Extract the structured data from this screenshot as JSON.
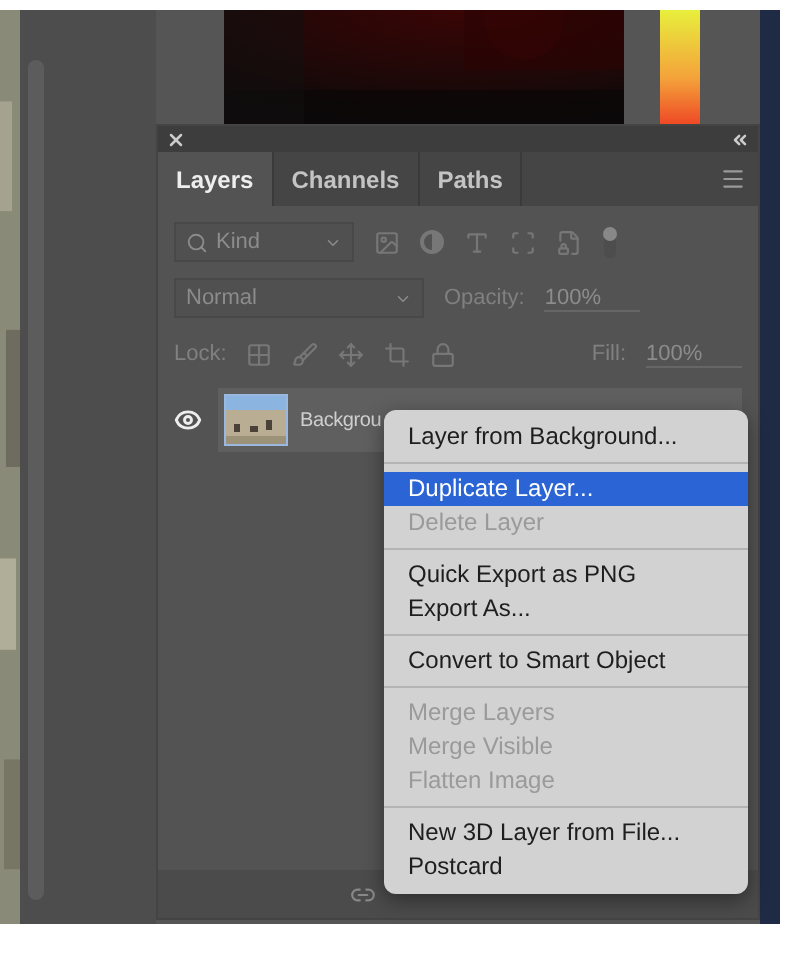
{
  "panel": {
    "tabs": [
      {
        "label": "Layers",
        "selected": true
      },
      {
        "label": "Channels",
        "selected": false
      },
      {
        "label": "Paths",
        "selected": false
      }
    ],
    "filter": {
      "placeholder": "Kind"
    },
    "blend_mode": {
      "value": "Normal"
    },
    "opacity": {
      "label": "Opacity:",
      "value": "100%"
    },
    "lock": {
      "label": "Lock:"
    },
    "fill": {
      "label": "Fill:",
      "value": "100%"
    },
    "layers": [
      {
        "name": "Backgrou",
        "visible": true
      }
    ]
  },
  "context_menu": {
    "groups": [
      [
        {
          "label": "Layer from Background...",
          "disabled": false,
          "selected": false
        }
      ],
      [
        {
          "label": "Duplicate Layer...",
          "disabled": false,
          "selected": true
        },
        {
          "label": "Delete Layer",
          "disabled": true,
          "selected": false
        }
      ],
      [
        {
          "label": "Quick Export as PNG",
          "disabled": false,
          "selected": false
        },
        {
          "label": "Export As...",
          "disabled": false,
          "selected": false
        }
      ],
      [
        {
          "label": "Convert to Smart Object",
          "disabled": false,
          "selected": false
        }
      ],
      [
        {
          "label": "Merge Layers",
          "disabled": true,
          "selected": false
        },
        {
          "label": "Merge Visible",
          "disabled": true,
          "selected": false
        },
        {
          "label": "Flatten Image",
          "disabled": true,
          "selected": false
        }
      ],
      [
        {
          "label": "New 3D Layer from File...",
          "disabled": false,
          "selected": false
        },
        {
          "label": "Postcard",
          "disabled": false,
          "selected": false
        }
      ]
    ]
  }
}
